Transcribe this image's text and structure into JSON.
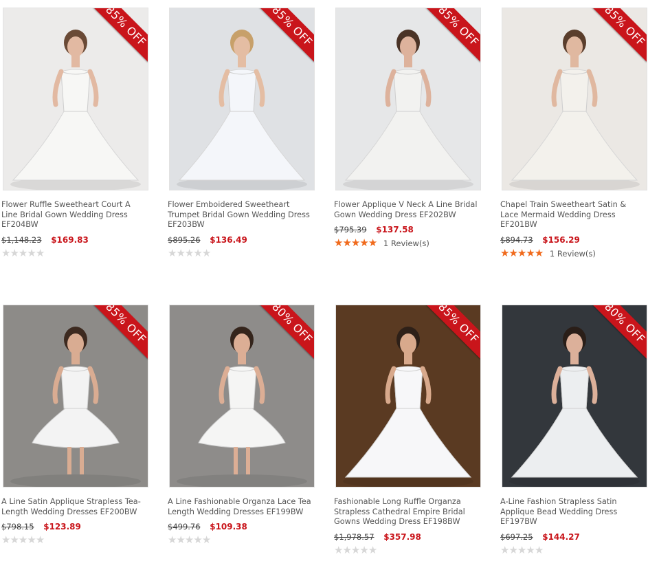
{
  "products": [
    {
      "title": "Flower Ruffle Sweetheart Court A Line Bridal Gown Wedding Dress EF204BW",
      "old_price": "$1,148.23",
      "new_price": "$169.83",
      "discount": "85% OFF",
      "rating": 0,
      "reviews": "",
      "bg": "#ecebea",
      "dress": "#f7f7f5",
      "skin": "#e2b9a2",
      "hair": "#6a4a36"
    },
    {
      "title": "Flower Emboidered Sweetheart Trumpet Bridal Gown Wedding Dress EF203BW",
      "old_price": "$895.26",
      "new_price": "$136.49",
      "discount": "85% OFF",
      "rating": 0,
      "reviews": "",
      "bg": "#dfe1e4",
      "dress": "#f4f6fa",
      "skin": "#e4bda3",
      "hair": "#c7a06a"
    },
    {
      "title": "Flower Applique V Neck A Line Bridal Gown Wedding Dress EF202BW",
      "old_price": "$795.39",
      "new_price": "$137.58",
      "discount": "85% OFF",
      "rating": 5,
      "reviews": "1 Review(s)",
      "bg": "#e6e7e8",
      "dress": "#f2f2f0",
      "skin": "#ddb29c",
      "hair": "#4a3326"
    },
    {
      "title": "Chapel Train Sweetheart Satin & Lace Mermaid Wedding Dress EF201BW",
      "old_price": "$894.73",
      "new_price": "$156.29",
      "discount": "85% OFF",
      "rating": 5,
      "reviews": "1 Review(s)",
      "bg": "#ebe8e4",
      "dress": "#f3f1ec",
      "skin": "#e0b8a0",
      "hair": "#5a3e2c"
    },
    {
      "title": "A Line Satin Applique Strapless Tea-Length Wedding Dresses EF200BW",
      "old_price": "$798.15",
      "new_price": "$123.89",
      "discount": "85% OFF",
      "rating": 0,
      "reviews": "",
      "bg": "#8d8b88",
      "dress": "#f3f3f3",
      "skin": "#d9ac92",
      "hair": "#3d2a20"
    },
    {
      "title": "A Line Fashionable Organza Lace Tea Length Wedding Dresses EF199BW",
      "old_price": "$499.76",
      "new_price": "$109.38",
      "discount": "80% OFF",
      "rating": 0,
      "reviews": "",
      "bg": "#8e8c8a",
      "dress": "#f5f5f4",
      "skin": "#dcae95",
      "hair": "#35251c"
    },
    {
      "title": "Fashionable Long Ruffle Organza Strapless Cathedral Empire Bridal Gowns Wedding Dress EF198BW",
      "old_price": "$1,978.57",
      "new_price": "$357.98",
      "discount": "85% OFF",
      "rating": 0,
      "reviews": "",
      "bg": "#5a3a22",
      "dress": "#f7f7f9",
      "skin": "#d8a98c",
      "hair": "#2e2018"
    },
    {
      "title": "A-Line Fashion Strapless Satin Applique Bead Wedding Dress EF197BW",
      "old_price": "$697.25",
      "new_price": "$144.27",
      "discount": "80% OFF",
      "rating": 0,
      "reviews": "",
      "bg": "#33373c",
      "dress": "#eceef0",
      "skin": "#dcb09a",
      "hair": "#2a1e18"
    }
  ],
  "colors": {
    "accent": "#c9151b",
    "star_on": "#f06a1c",
    "star_off": "#d7d7d7"
  }
}
